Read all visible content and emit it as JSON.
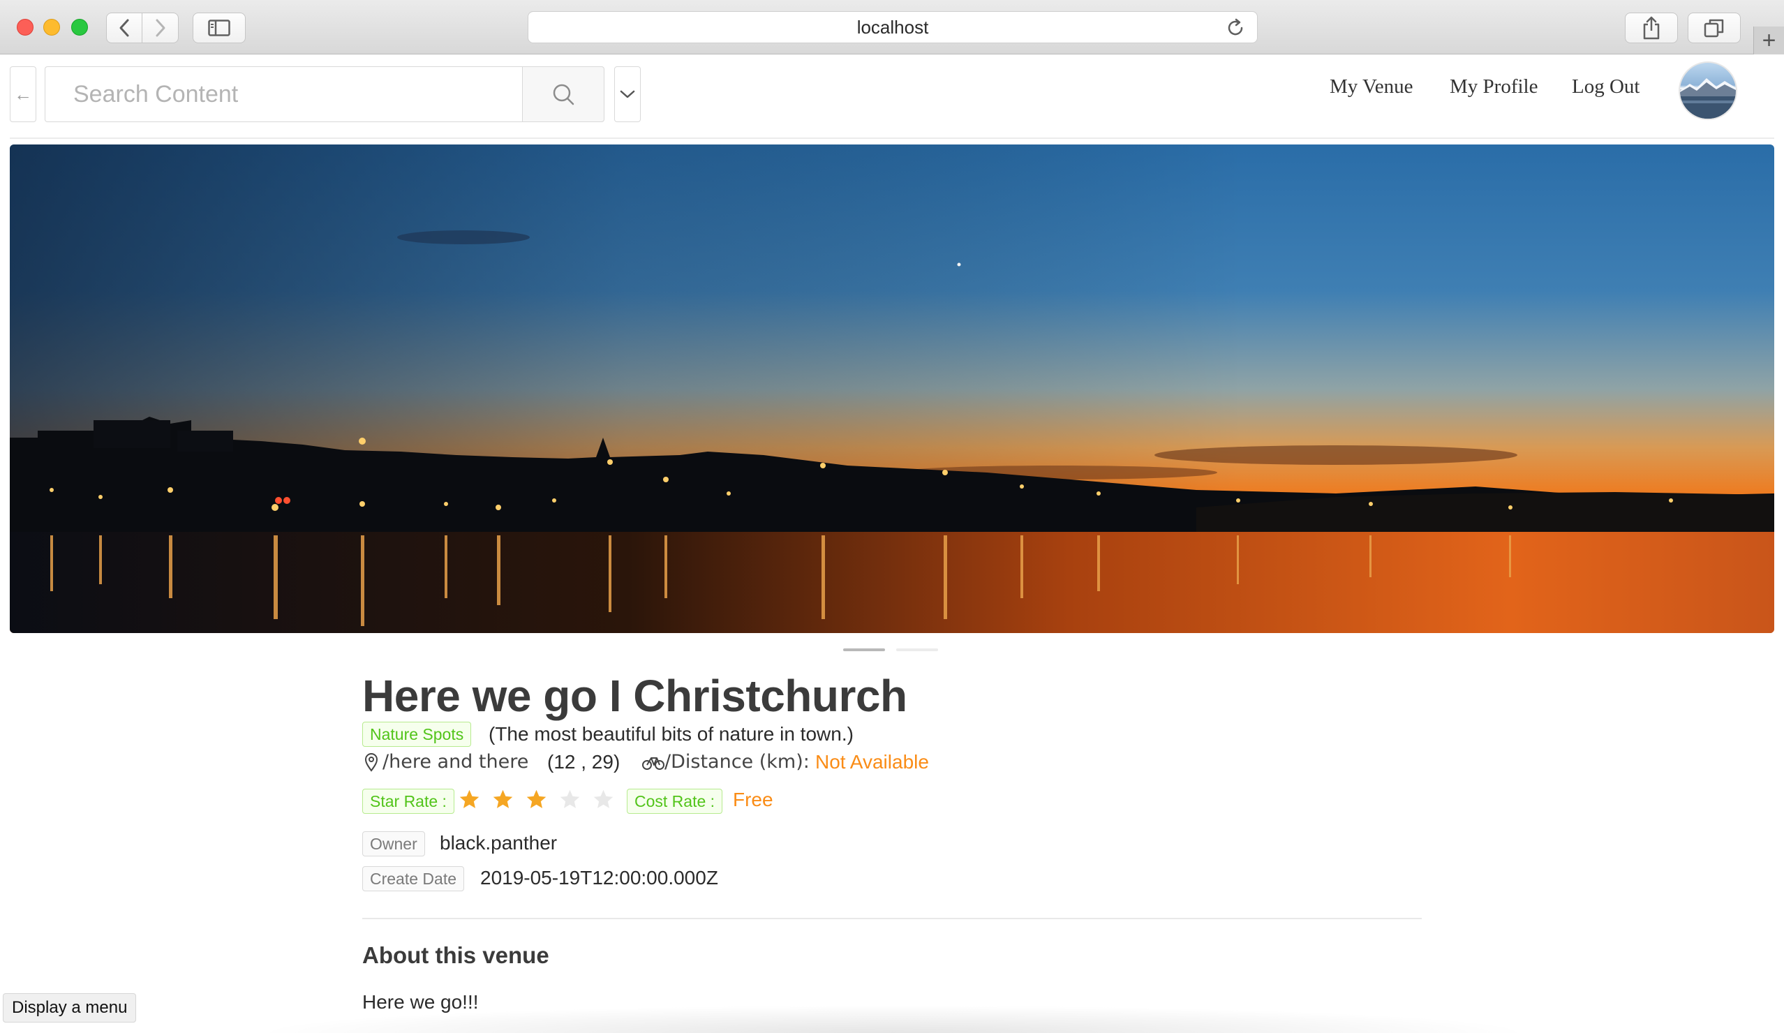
{
  "browser": {
    "url": "localhost",
    "icons": [
      "close-window",
      "minimize-window",
      "zoom-window",
      "chevron-left",
      "chevron-right",
      "sidebar",
      "reload",
      "share",
      "tabs-overview",
      "plus"
    ]
  },
  "header": {
    "search_placeholder": "Search Content",
    "nav": {
      "my_venue": "My Venue",
      "my_profile": "My Profile",
      "log_out": "Log Out"
    }
  },
  "venue": {
    "title": "Here we go I Christchurch",
    "category": "Nature Spots",
    "category_description": "(The most beautiful bits of nature in town.)",
    "address": "/here and there",
    "coordinates": "(12 , 29)",
    "distance_label": "/Distance (km):",
    "distance_value": "Not Available",
    "star_rate_label": "Star Rate :",
    "star_rating": 3,
    "star_max": 5,
    "cost_rate_label": "Cost Rate :",
    "cost_rate_value": "Free",
    "owner_label": "Owner",
    "owner": "black.panther",
    "create_date_label": "Create Date",
    "create_date": "2019-05-19T12:00:00.000Z",
    "about_title": "About this venue",
    "about_text": "Here we go!!!"
  },
  "carousel": {
    "slides": 2,
    "active": 1
  },
  "colors": {
    "accent_green": "#52c41a",
    "accent_orange": "#fa8c16",
    "star_gold": "#fadb14",
    "star_inactive": "#e8e8e8"
  },
  "tooltip": "Display a menu"
}
